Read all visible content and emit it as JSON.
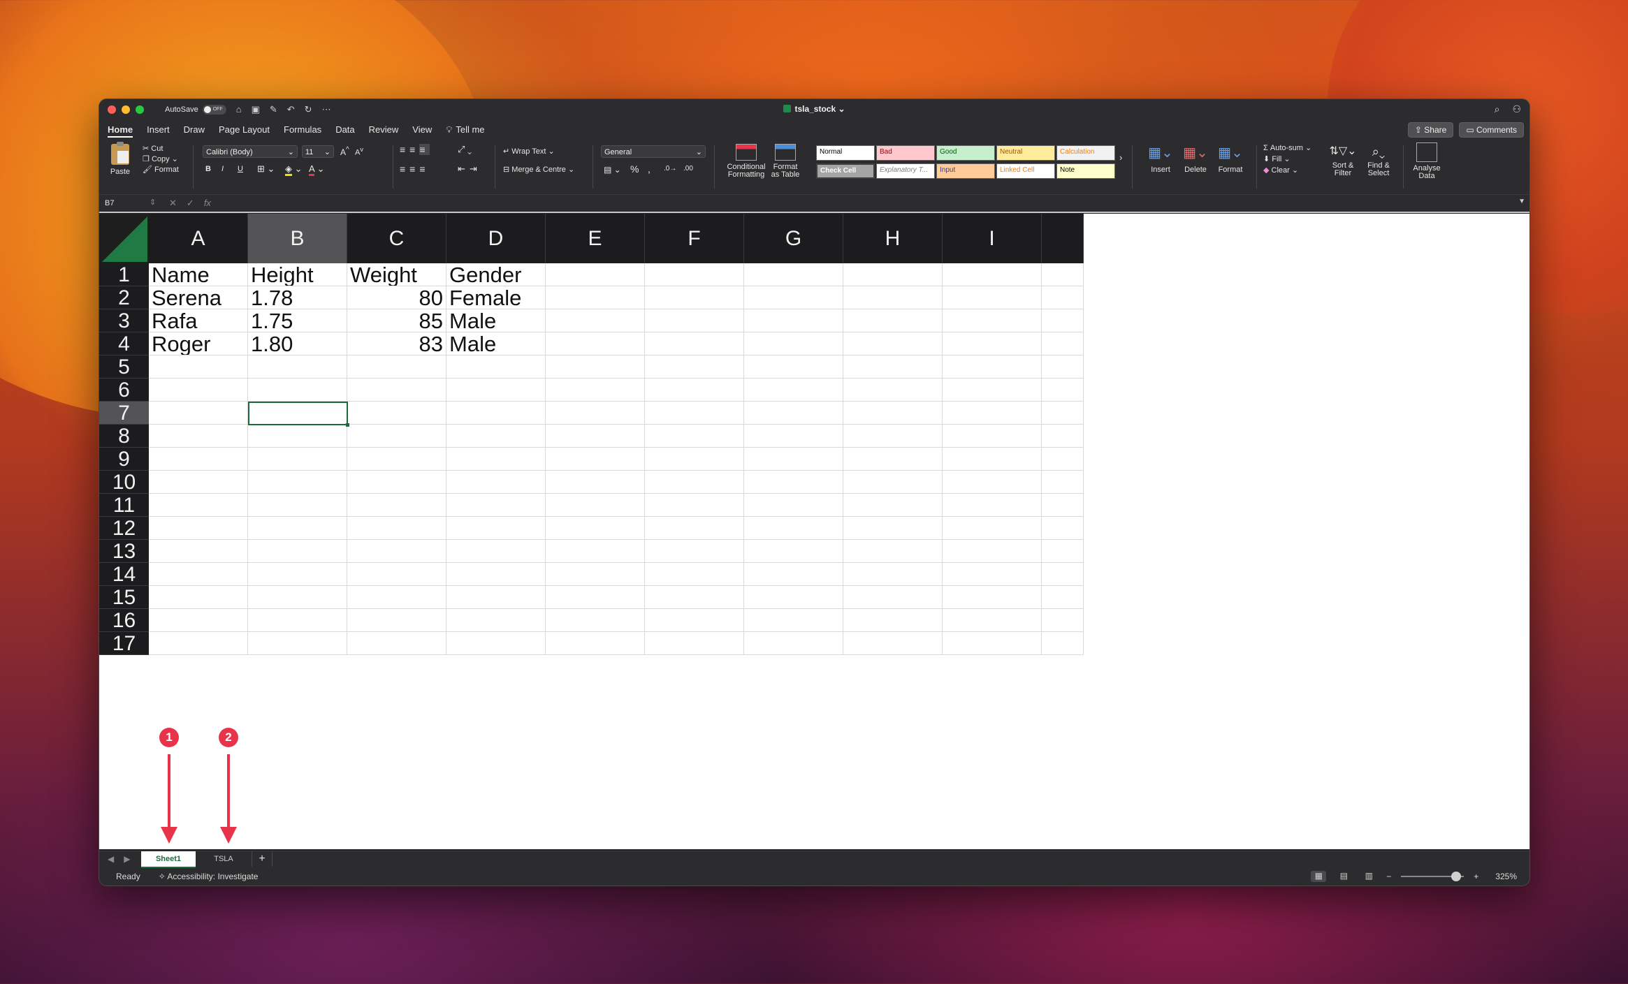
{
  "window": {
    "autosave_label": "AutoSave",
    "autosave_state": "OFF",
    "document_title": "tsla_stock"
  },
  "ribbon_tabs": [
    "Home",
    "Insert",
    "Draw",
    "Page Layout",
    "Formulas",
    "Data",
    "Review",
    "View"
  ],
  "tell_me": "Tell me",
  "share_label": "Share",
  "comments_label": "Comments",
  "ribbon": {
    "paste": "Paste",
    "cut": "Cut",
    "copy": "Copy",
    "format_painter": "Format",
    "font_name": "Calibri (Body)",
    "font_size": "11",
    "bold": "B",
    "italic": "I",
    "underline": "U",
    "wrap_text": "Wrap Text",
    "merge_centre": "Merge & Centre",
    "number_format": "General",
    "conditional_formatting": [
      "Conditional",
      "Formatting"
    ],
    "format_as_table": [
      "Format",
      "as Table"
    ],
    "cell_styles": [
      {
        "label": "Normal",
        "bg": "#ffffff",
        "fg": "#000000"
      },
      {
        "label": "Bad",
        "bg": "#ffc7ce",
        "fg": "#9c0006"
      },
      {
        "label": "Good",
        "bg": "#c6efce",
        "fg": "#006100"
      },
      {
        "label": "Neutral",
        "bg": "#ffeb9c",
        "fg": "#9c5700"
      },
      {
        "label": "Calculation",
        "bg": "#f2f2f2",
        "fg": "#fa7d00"
      },
      {
        "label": "Check Cell",
        "bg": "#a5a5a5",
        "fg": "#ffffff"
      },
      {
        "label": "Explanatory T...",
        "bg": "#ffffff",
        "fg": "#7f7f7f"
      },
      {
        "label": "Input",
        "bg": "#ffcc99",
        "fg": "#3f3f76"
      },
      {
        "label": "Linked Cell",
        "bg": "#ffffff",
        "fg": "#fa7d00"
      },
      {
        "label": "Note",
        "bg": "#ffffcc",
        "fg": "#000000"
      }
    ],
    "insert": "Insert",
    "delete": "Delete",
    "format": "Format",
    "autosum": "Auto-sum",
    "fill": "Fill",
    "clear": "Clear",
    "sort_filter": [
      "Sort &",
      "Filter"
    ],
    "find_select": [
      "Find &",
      "Select"
    ],
    "analyse_data": [
      "Analyse",
      "Data"
    ]
  },
  "formula_bar": {
    "name_box": "B7",
    "fx": "fx",
    "content": ""
  },
  "columns": [
    "A",
    "B",
    "C",
    "D",
    "E",
    "F",
    "G",
    "H",
    "I"
  ],
  "rows": [
    "1",
    "2",
    "3",
    "4",
    "5",
    "6",
    "7",
    "8",
    "9",
    "10",
    "11",
    "12",
    "13",
    "14",
    "15",
    "16",
    "17"
  ],
  "cells": [
    [
      "Name",
      "Height",
      "Weight",
      "Gender"
    ],
    [
      "Serena",
      "1.78",
      "80",
      "Female"
    ],
    [
      "Rafa",
      "1.75",
      "85",
      "Male"
    ],
    [
      "Roger",
      "1.80",
      "83",
      "Male"
    ]
  ],
  "selected_cell": "B7",
  "annotations": [
    "1",
    "2"
  ],
  "sheets": [
    {
      "name": "Sheet1",
      "active": true
    },
    {
      "name": "TSLA",
      "active": false
    }
  ],
  "status": {
    "ready": "Ready",
    "accessibility": "Accessibility: Investigate",
    "zoom": "325%",
    "zoom_minus": "−",
    "zoom_plus": "+"
  },
  "colors": {
    "accent_green": "#1d6b3c",
    "annotation_red": "#e8344a"
  }
}
